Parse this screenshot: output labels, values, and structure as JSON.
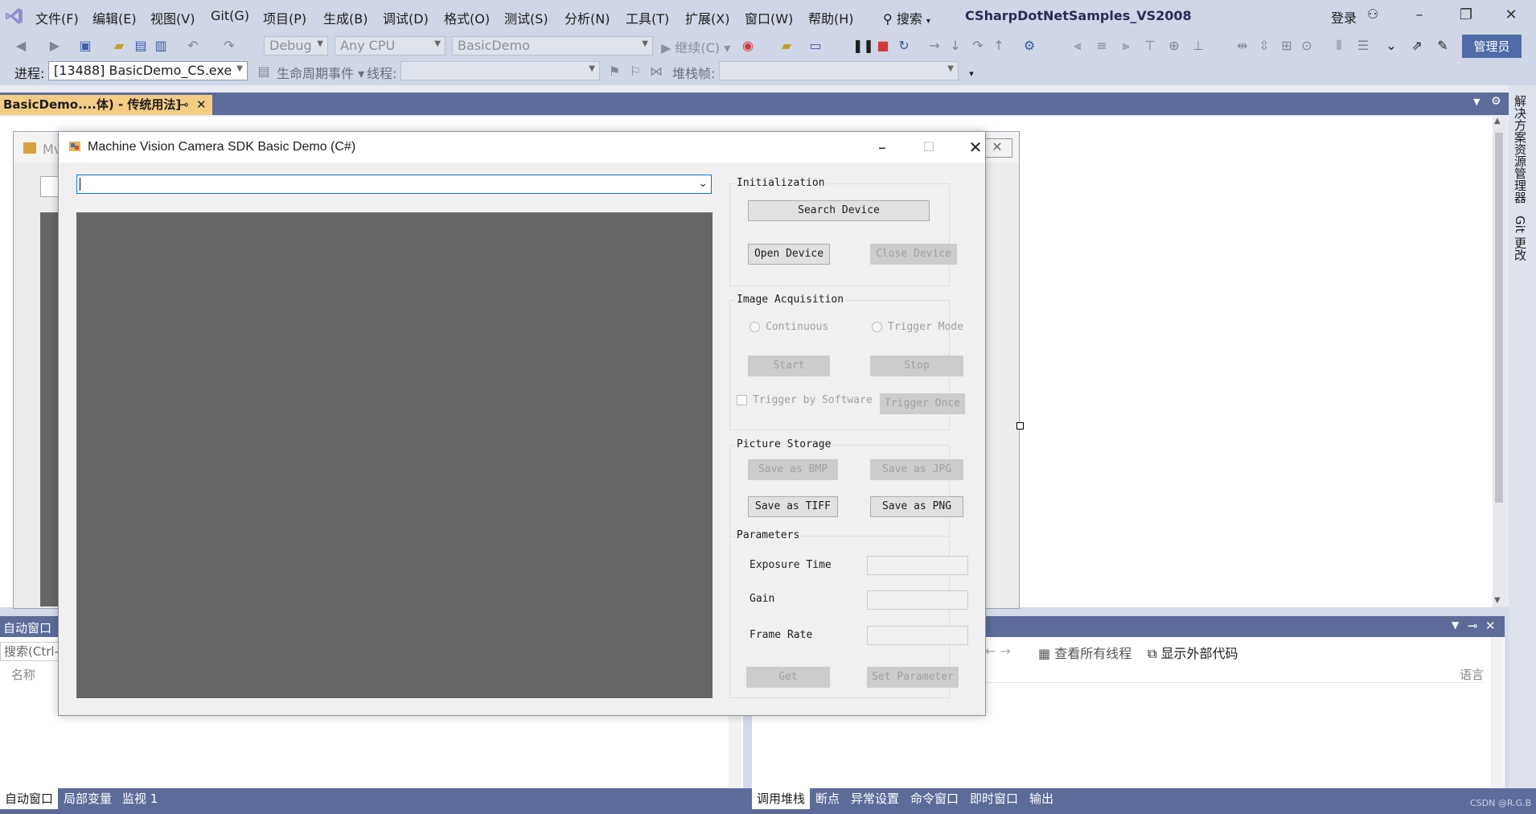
{
  "menubar": {
    "items": [
      "文件(F)",
      "编辑(E)",
      "视图(V)",
      "Git(G)",
      "项目(P)",
      "生成(B)",
      "调试(D)",
      "格式(O)",
      "测试(S)",
      "分析(N)",
      "工具(T)",
      "扩展(X)",
      "窗口(W)",
      "帮助(H)"
    ],
    "search_label": "搜索",
    "solution_title": "CSharpDotNetSamples_VS2008",
    "login_label": "登录"
  },
  "toolbar": {
    "config": "Debug",
    "platform": "Any CPU",
    "startup_project": "BasicDemo",
    "continue_label": "继续(C)",
    "admin_label": "管理员"
  },
  "debug_toolbar": {
    "process_label": "进程:",
    "process_value": "[13488] BasicDemo_CS.exe",
    "lifecycle_label": "生命周期事件",
    "thread_label": "线程:",
    "stackframe_label": "堆栈帧:"
  },
  "document_tab": {
    "label": "BasicDemo....体) - 传统用法]"
  },
  "designer_ghost_title": "Mv",
  "side_tabs": [
    "解决方案资源管理器",
    "Git 更改"
  ],
  "bottom_left": {
    "title": "自动窗口",
    "search_placeholder": "搜索(Ctrl-",
    "col_name": "名称",
    "tabs": [
      "自动窗口",
      "局部变量",
      "监视 1"
    ]
  },
  "bottom_right": {
    "view_all_threads": "查看所有线程",
    "show_external_code": "显示外部代码",
    "col_language": "语言",
    "tabs": [
      "调用堆栈",
      "断点",
      "异常设置",
      "命令窗口",
      "即时窗口",
      "输出"
    ]
  },
  "watermark": "CSDN @R.G.B",
  "app": {
    "title": "Machine Vision Camera SDK Basic Demo (C#)",
    "device_value": "",
    "initialization": {
      "label": "Initialization",
      "search_device": "Search Device",
      "open_device": "Open Device",
      "close_device": "Close Device"
    },
    "acquisition": {
      "label": "Image Acquisition",
      "continuous": "Continuous",
      "trigger_mode": "Trigger Mode",
      "start": "Start",
      "stop": "Stop",
      "trigger_by_software": "Trigger by Software",
      "trigger_once": "Trigger Once"
    },
    "storage": {
      "label": "Picture Storage",
      "save_bmp": "Save as BMP",
      "save_jpg": "Save as JPG",
      "save_tiff": "Save as TIFF",
      "save_png": "Save as PNG"
    },
    "parameters": {
      "label": "Parameters",
      "exposure_time": "Exposure Time",
      "gain": "Gain",
      "frame_rate": "Frame Rate",
      "get": "Get",
      "set_parameter": "Set Parameter"
    }
  }
}
